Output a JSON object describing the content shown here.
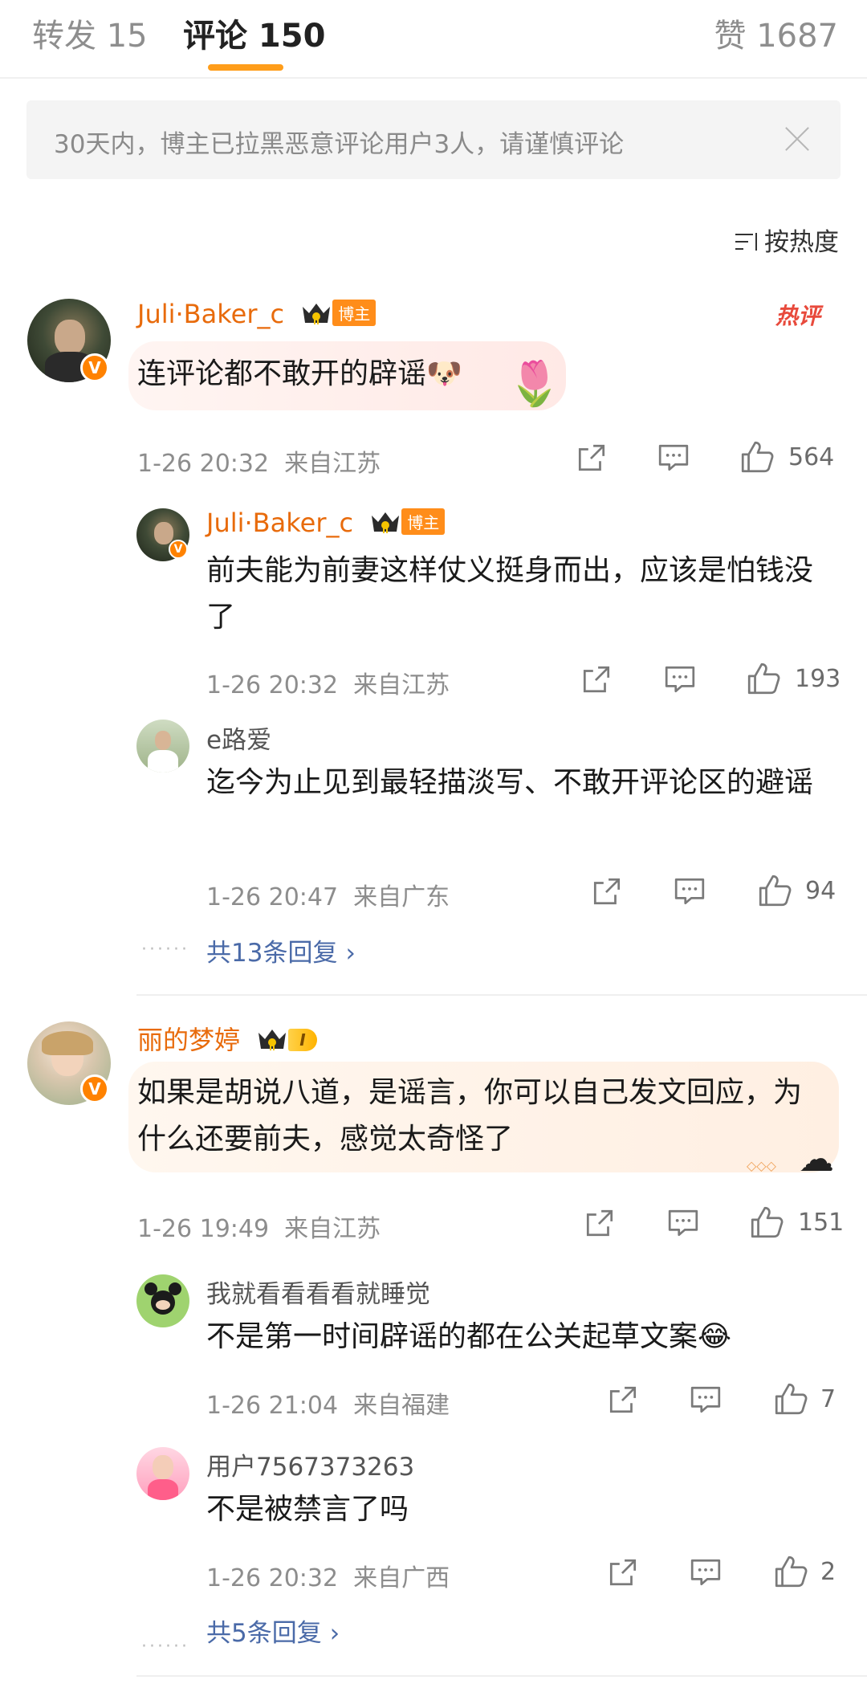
{
  "tabs": {
    "repost": "转发 15",
    "comments": "评论 150",
    "likes": "赞 1687"
  },
  "notice": {
    "text": "30天内，博主已拉黑恶意评论用户3人，请谨慎评论"
  },
  "sort": {
    "label": "按热度"
  },
  "hot_label": "热评",
  "bozhu_tag": "博主",
  "fan_level": "I",
  "comments": [
    {
      "name": "Juli·Baker_c",
      "text": "连评论都不敢开的辟谣",
      "time": "1-26 20:32",
      "location": "来自江苏",
      "likes": "564",
      "replies": [
        {
          "name": "Juli·Baker_c",
          "text": "前夫能为前妻这样仗义挺身而出，应该是怕钱没了",
          "time": "1-26 20:32",
          "location": "来自江苏",
          "likes": "193"
        },
        {
          "name": "e路爱",
          "text": "迄今为止见到最轻描淡写、不敢开评论区的避谣",
          "time": "1-26 20:47",
          "location": "来自广东",
          "likes": "94"
        }
      ],
      "more_replies": "共13条回复"
    },
    {
      "name": "丽的梦婷",
      "text": "如果是胡说八道，是谣言，你可以自己发文回应，为什么还要前夫，感觉太奇怪了",
      "time": "1-26 19:49",
      "location": "来自江苏",
      "likes": "151",
      "replies": [
        {
          "name": "我就看看看看就睡觉",
          "text": "不是第一时间辟谣的都在公关起草文案",
          "time": "1-26 21:04",
          "location": "来自福建",
          "likes": "7"
        },
        {
          "name": "用户7567373263",
          "text": "不是被禁言了吗",
          "time": "1-26 20:32",
          "location": "来自广西",
          "likes": "2"
        }
      ],
      "more_replies": "共5条回复"
    }
  ],
  "colors": {
    "accent": "#ff9d1a",
    "username": "#e86b0c",
    "link": "#4a6aa8",
    "hot": "#e84a3c"
  }
}
